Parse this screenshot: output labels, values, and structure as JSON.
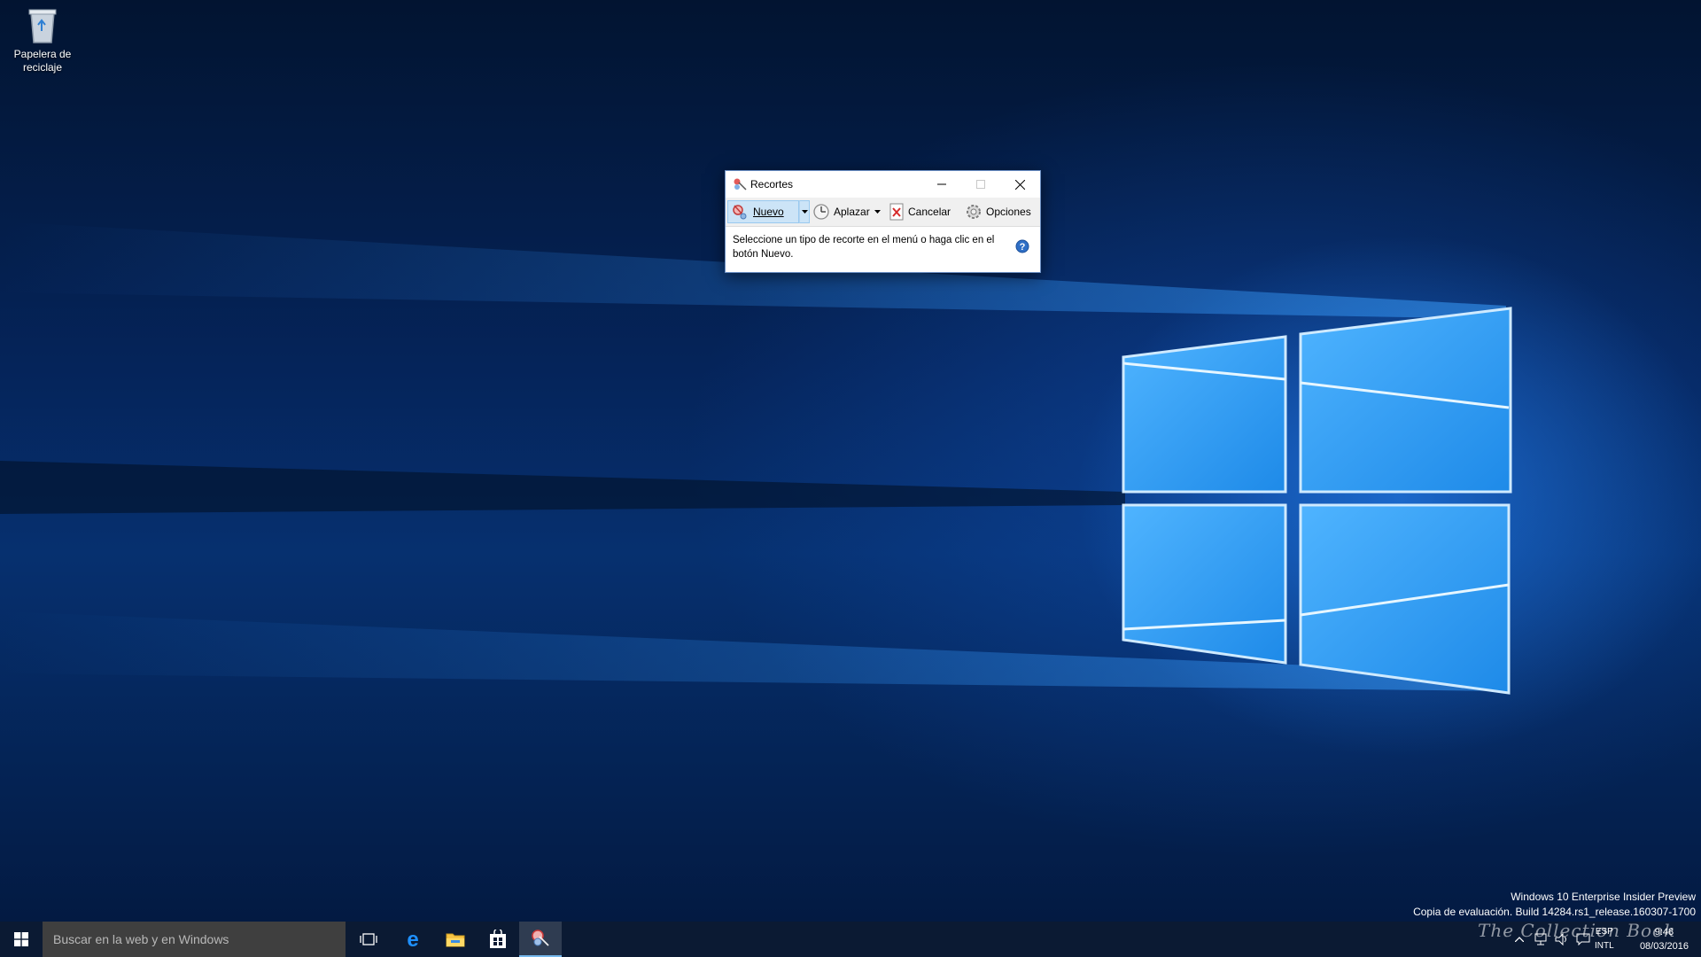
{
  "desktop": {
    "icons": [
      {
        "label": "Papelera de reciclaje",
        "icon": "recycle-bin-icon"
      }
    ]
  },
  "snipping_tool": {
    "title": "Recortes",
    "toolbar": {
      "nuevo": "Nuevo",
      "aplazar": "Aplazar",
      "cancelar": "Cancelar",
      "opciones": "Opciones"
    },
    "message": "Seleccione un tipo de recorte en el menú o haga clic en el botón Nuevo."
  },
  "watermark": {
    "line1": "Windows 10 Enterprise Insider Preview",
    "line2": "Copia de evaluación. Build 14284.rs1_release.160307-1700"
  },
  "overlay_text": "The Collection Book",
  "taskbar": {
    "search_placeholder": "Buscar en la web y en Windows",
    "apps": [
      "task-view-icon",
      "edge-icon",
      "file-explorer-icon",
      "store-icon",
      "snipping-tool-icon"
    ],
    "language": {
      "code": "ESP",
      "layout": "INTL"
    },
    "clock": {
      "time": "9:48",
      "date": "08/03/2016"
    }
  },
  "colors": {
    "taskbar": "#0b1a33",
    "search_box": "#3f3f3f",
    "accent": "#76b9ed",
    "nuevo_highlight": "#cce4f7"
  }
}
